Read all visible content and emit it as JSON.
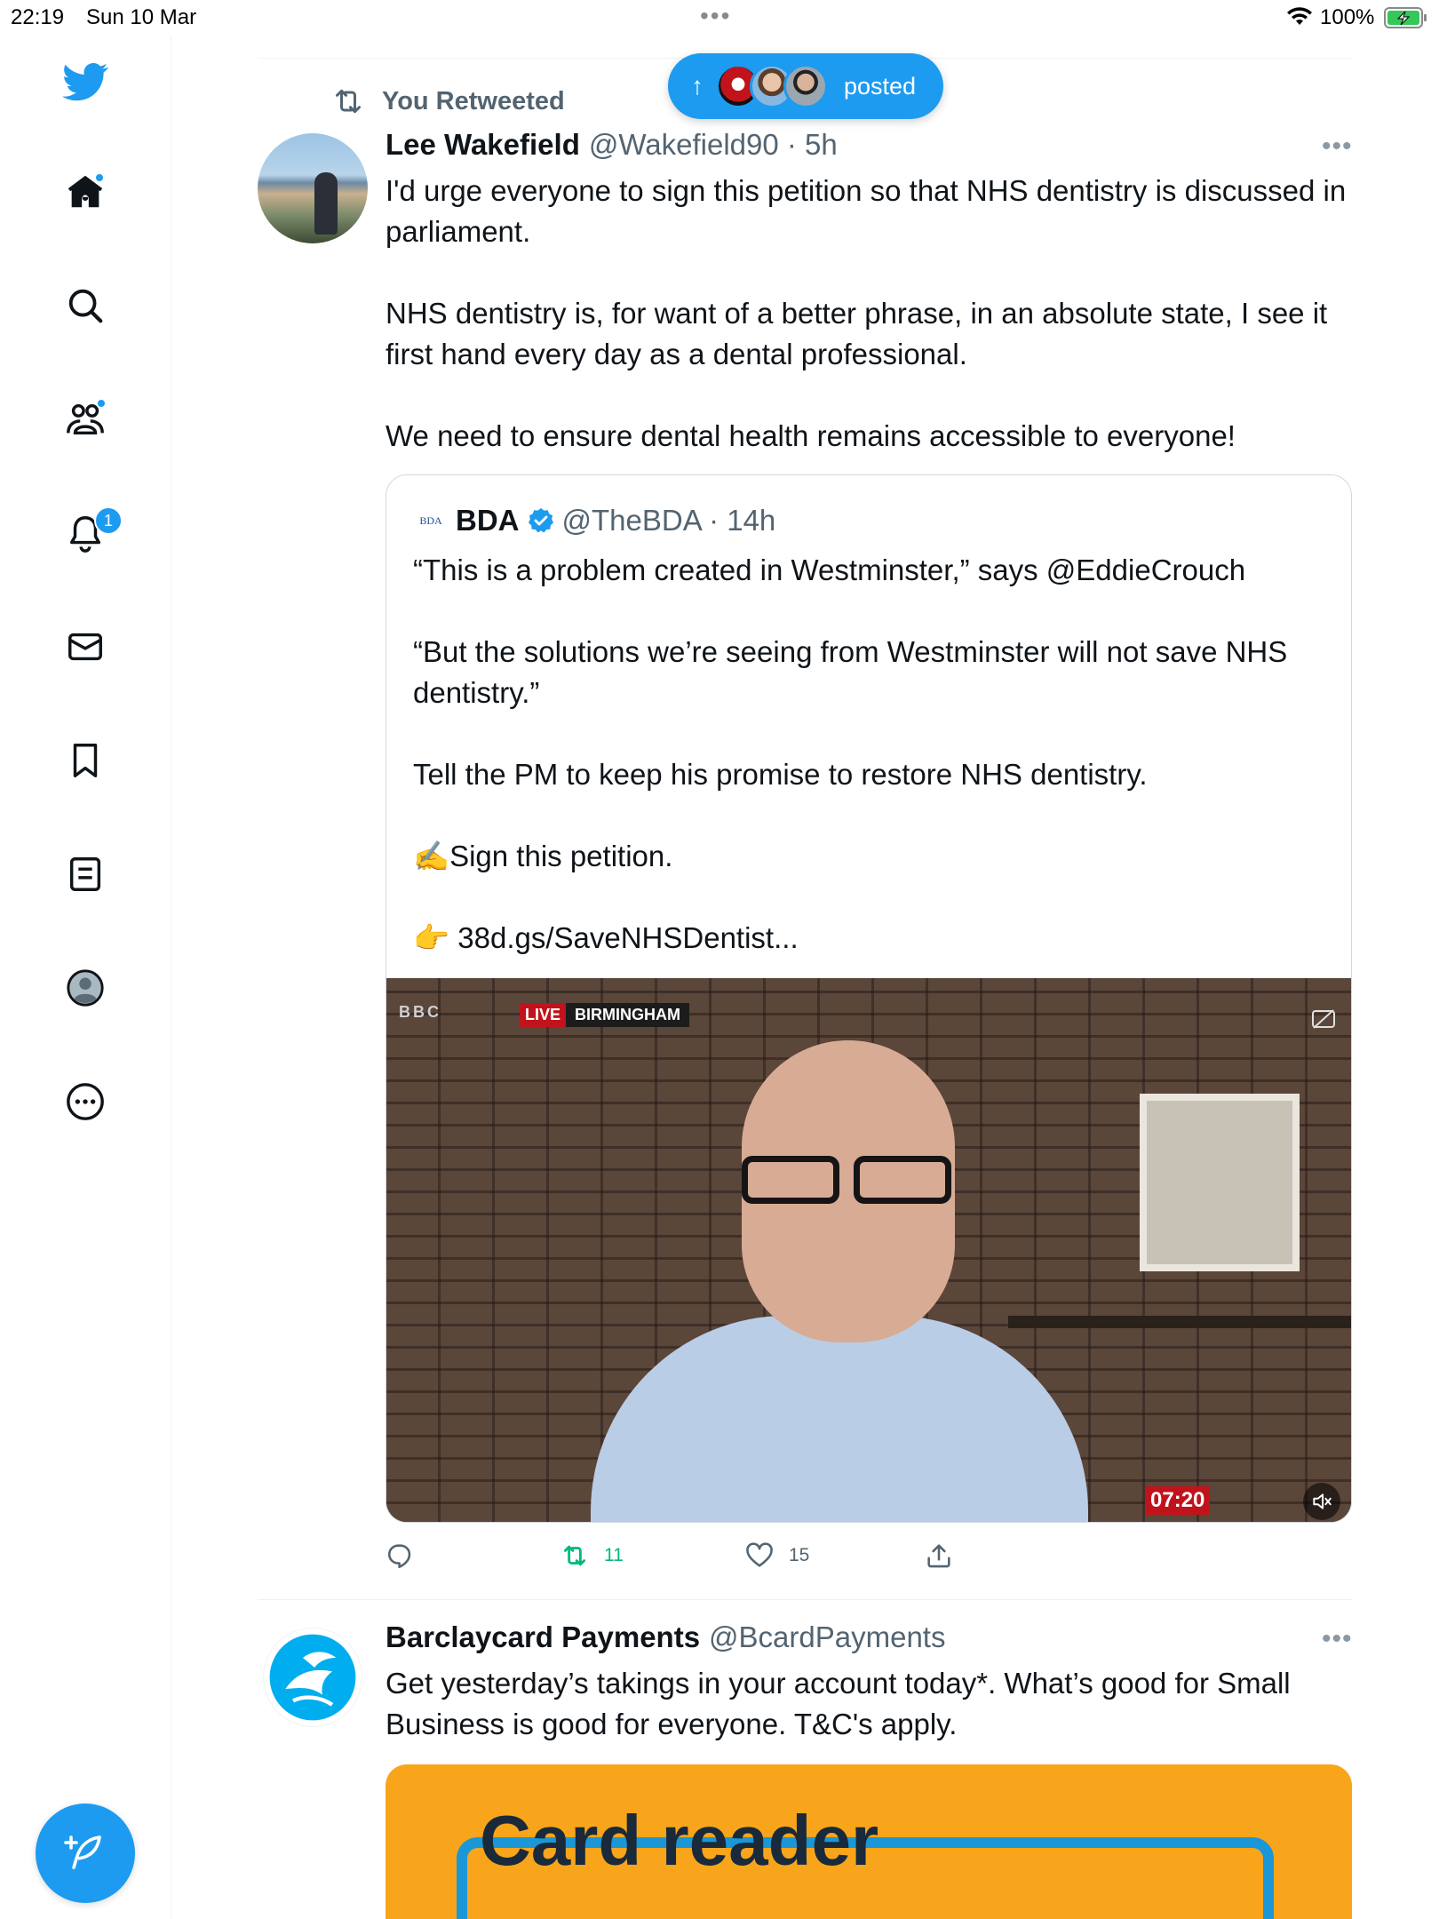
{
  "status_bar": {
    "time": "22:19",
    "date": "Sun 10 Mar",
    "battery": "100%"
  },
  "nav": {
    "items": [
      "home",
      "explore",
      "communities",
      "notifications",
      "messages",
      "bookmarks",
      "lists",
      "profile",
      "more"
    ],
    "notification_count": "1",
    "accent": "#1d9bf0"
  },
  "new_posts_pill": {
    "label": "posted"
  },
  "tweets": [
    {
      "retweet_label": "You Retweeted",
      "name": "Lee Wakefield",
      "handle": "@Wakefield90 · 5h",
      "text": "I'd urge everyone to sign this petition so that NHS dentistry is discussed in parliament.\n\nNHS dentistry is, for want of a better phrase, in an absolute state, I see it first hand every day as a dental professional.\n\nWe need to ensure dental health remains accessible to everyone!",
      "quote": {
        "logo_text": "BDA",
        "name": "BDA",
        "handle": "@TheBDA · 14h",
        "text": "“This is a problem created in Westminster,” says @EddieCrouch\n\n“But the solutions we’re seeing from Westminster will not save NHS dentistry.”\n\nTell the PM to keep his promise to restore NHS dentistry.\n\n✍️Sign this petition.\n\n👉 38d.gs/SaveNHSDentist...",
        "video": {
          "channel": "BBC",
          "live": "LIVE",
          "location": "BIRMINGHAM",
          "duration": "07:20"
        }
      },
      "actions": {
        "replies": "",
        "retweets": "11",
        "likes": "15"
      },
      "retweet_color": "#00ba7c"
    },
    {
      "name": "Barclaycard Payments",
      "handle": "@BcardPayments",
      "text": "Get yesterday’s takings in your account today*. What’s good for Small Business is good for everyone. T&C's apply.",
      "image_text": "Card reader"
    }
  ]
}
